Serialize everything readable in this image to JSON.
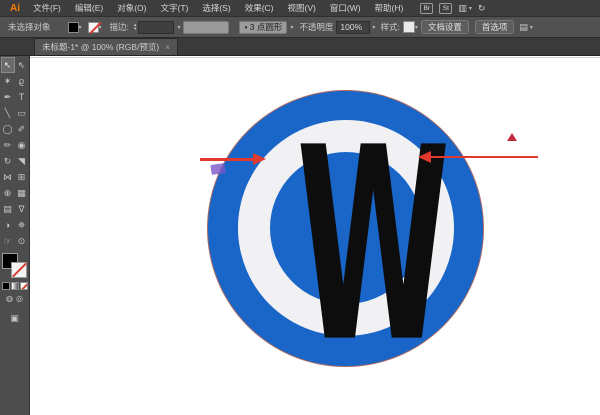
{
  "menubar": {
    "logo": "Ai",
    "items": [
      {
        "label": "文件(F)"
      },
      {
        "label": "编辑(E)"
      },
      {
        "label": "对象(O)"
      },
      {
        "label": "文字(T)"
      },
      {
        "label": "选择(S)"
      },
      {
        "label": "效果(C)"
      },
      {
        "label": "视图(V)"
      },
      {
        "label": "窗口(W)"
      },
      {
        "label": "帮助(H)"
      }
    ],
    "bridge_label": "Br",
    "stock_label": "St"
  },
  "optionsbar": {
    "no_selection_label": "未选择对象",
    "stroke_label": "描边:",
    "brush_value": "• 3 点圆形",
    "opacity_label": "不透明度",
    "opacity_value": "100%",
    "style_label": "样式:",
    "doc_setup_label": "文档设置",
    "preferences_label": "首选项"
  },
  "tabbar": {
    "title": "未标题-1* @ 100% (RGB/预览)",
    "close": "×"
  },
  "toolbar": {
    "tools": [
      {
        "name": "selection",
        "glyph": "↖"
      },
      {
        "name": "direct-selection",
        "glyph": "⇖"
      },
      {
        "name": "magic-wand",
        "glyph": "✶"
      },
      {
        "name": "lasso",
        "glyph": "ϱ"
      },
      {
        "name": "pen",
        "glyph": "✒"
      },
      {
        "name": "type",
        "glyph": "T"
      },
      {
        "name": "line-segment",
        "glyph": "╲"
      },
      {
        "name": "rectangle",
        "glyph": "▭"
      },
      {
        "name": "ellipse",
        "glyph": "◯"
      },
      {
        "name": "paintbrush",
        "glyph": "✐"
      },
      {
        "name": "pencil",
        "glyph": "✏"
      },
      {
        "name": "blob-brush",
        "glyph": "◉"
      },
      {
        "name": "rotate",
        "glyph": "↻"
      },
      {
        "name": "scale",
        "glyph": "◥"
      },
      {
        "name": "width",
        "glyph": "⋈"
      },
      {
        "name": "free-transform",
        "glyph": "⊞"
      },
      {
        "name": "shape-builder",
        "glyph": "⊕"
      },
      {
        "name": "mesh",
        "glyph": "▦"
      },
      {
        "name": "gradient",
        "glyph": "▤"
      },
      {
        "name": "eyedropper",
        "glyph": "∇"
      },
      {
        "name": "blend",
        "glyph": "◑"
      },
      {
        "name": "symbol-sprayer",
        "glyph": "✵"
      },
      {
        "name": "hand",
        "glyph": "☞"
      },
      {
        "name": "zoom",
        "glyph": "⊙"
      }
    ]
  },
  "canvas": {
    "letter": "W",
    "colors": {
      "blue": "#1966c8",
      "ring": "#f1f1f4",
      "letter": "#0d0d0d",
      "annotation_red": "#e0392e",
      "triangle_red": "#c4293a"
    }
  }
}
